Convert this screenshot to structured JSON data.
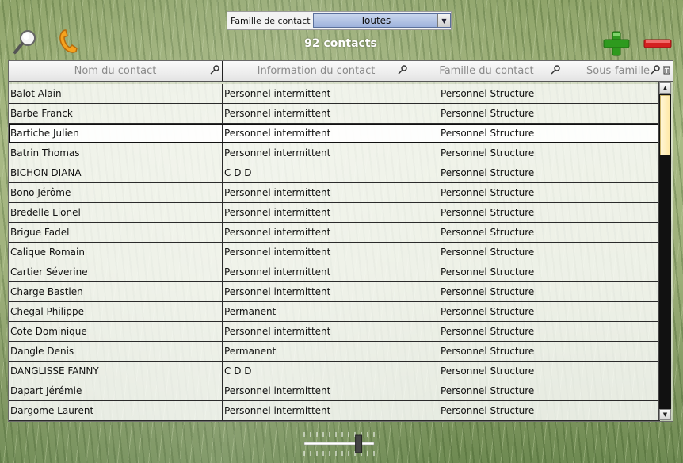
{
  "family_filter": {
    "label": "Famille de contact",
    "selected": "Toutes"
  },
  "contact_count": "92 contacts",
  "icons": {
    "search": "magnifier-icon",
    "phone": "phone-icon",
    "add": "plus-icon",
    "remove": "minus-icon",
    "add_color": "#2e9a1e",
    "remove_color": "#d42020"
  },
  "table": {
    "columns": [
      "Nom du contact",
      "Information du contact",
      "Famille du contact",
      "Sous-famille"
    ],
    "rows": [
      {
        "name": "Balot Alain",
        "info": "Personnel intermittent",
        "family": "Personnel Structure",
        "sub": ""
      },
      {
        "name": "Barbe Franck",
        "info": "Personnel intermittent",
        "family": "Personnel Structure",
        "sub": ""
      },
      {
        "name": "Bartiche Julien",
        "info": "Personnel intermittent",
        "family": "Personnel Structure",
        "sub": ""
      },
      {
        "name": "Batrin Thomas",
        "info": "Personnel intermittent",
        "family": "Personnel Structure",
        "sub": ""
      },
      {
        "name": "BICHON DIANA",
        "info": "C D D",
        "family": "Personnel Structure",
        "sub": ""
      },
      {
        "name": "Bono Jérôme",
        "info": "Personnel intermittent",
        "family": "Personnel Structure",
        "sub": ""
      },
      {
        "name": "Bredelle Lionel",
        "info": "Personnel intermittent",
        "family": "Personnel Structure",
        "sub": ""
      },
      {
        "name": "Brigue Fadel",
        "info": "Personnel intermittent",
        "family": "Personnel Structure",
        "sub": ""
      },
      {
        "name": "Calique Romain",
        "info": "Personnel intermittent",
        "family": "Personnel Structure",
        "sub": ""
      },
      {
        "name": "Cartier Séverine",
        "info": "Personnel intermittent",
        "family": "Personnel Structure",
        "sub": ""
      },
      {
        "name": "Charge Bastien",
        "info": "Personnel intermittent",
        "family": "Personnel Structure",
        "sub": ""
      },
      {
        "name": "Chegal Philippe",
        "info": "Permanent",
        "family": "Personnel Structure",
        "sub": ""
      },
      {
        "name": "Cote Dominique",
        "info": "Personnel intermittent",
        "family": "Personnel Structure",
        "sub": ""
      },
      {
        "name": "Dangle Denis",
        "info": "Permanent",
        "family": "Personnel Structure",
        "sub": ""
      },
      {
        "name": "DANGLISSE FANNY",
        "info": "C D D",
        "family": "Personnel Structure",
        "sub": ""
      },
      {
        "name": "Dapart Jérémie",
        "info": "Personnel intermittent",
        "family": "Personnel Structure",
        "sub": ""
      },
      {
        "name": "Dargome Laurent",
        "info": "Personnel intermittent",
        "family": "Personnel Structure",
        "sub": ""
      }
    ],
    "selected_row": 2
  },
  "zoom_slider": {
    "level": 0.78
  }
}
